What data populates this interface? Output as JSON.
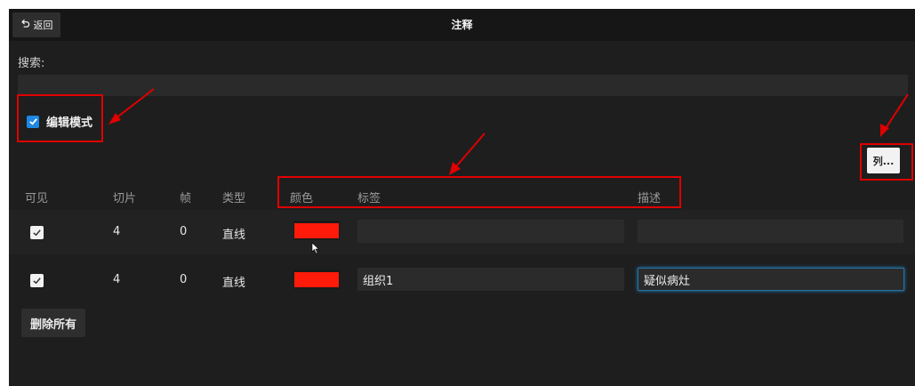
{
  "titlebar": {
    "back_label": "返回",
    "title": "注释"
  },
  "search": {
    "label": "搜索:",
    "value": ""
  },
  "edit_mode": {
    "label": "编辑模式",
    "checked": true
  },
  "columns_button": {
    "label": "列..."
  },
  "table": {
    "headers": [
      "可见",
      "切片",
      "帧",
      "类型",
      "颜色",
      "标签",
      "描述"
    ],
    "rows": [
      {
        "visible": true,
        "slice": "4",
        "frame": "0",
        "type": "直线",
        "color": "#ff1a0a",
        "label": "",
        "description": ""
      },
      {
        "visible": true,
        "slice": "4",
        "frame": "0",
        "type": "直线",
        "color": "#ff1a0a",
        "label": "组织1",
        "description": "疑似病灶"
      }
    ]
  },
  "delete_all": {
    "label": "删除所有"
  },
  "colors": {
    "window_bg": "#1e1e1e",
    "titlebar_bg": "#161616",
    "accent_blue": "#1e88e5",
    "annotation_red": "#e00000"
  }
}
